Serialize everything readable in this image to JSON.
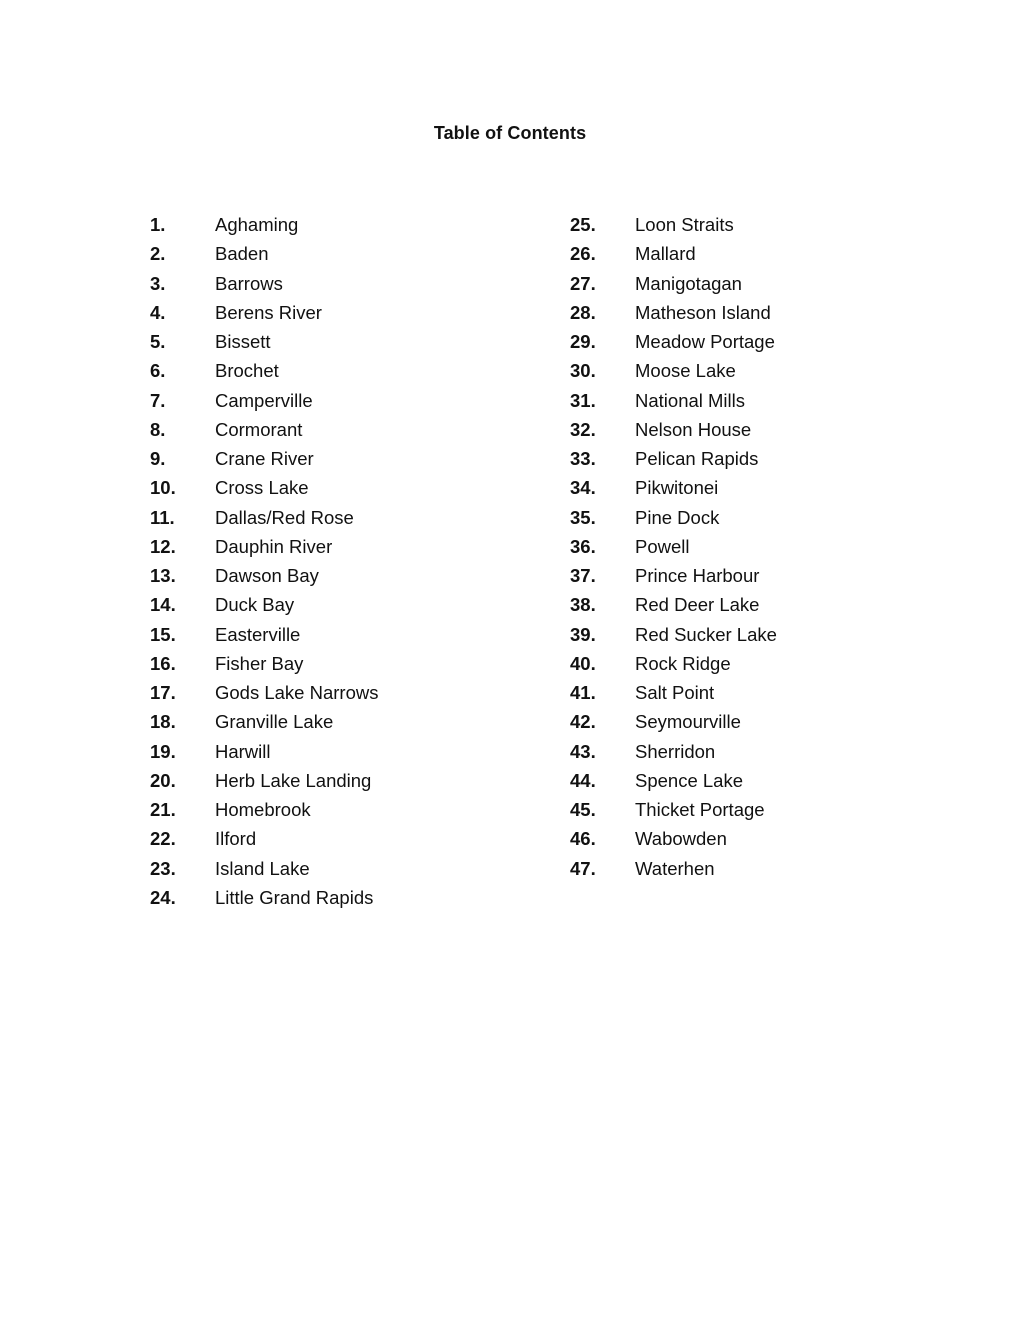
{
  "document": {
    "title": "Table of Contents",
    "columns": [
      {
        "entries": [
          {
            "number": "1.",
            "name": "Aghaming"
          },
          {
            "number": "2.",
            "name": "Baden"
          },
          {
            "number": "3.",
            "name": "Barrows"
          },
          {
            "number": "4.",
            "name": "Berens River"
          },
          {
            "number": "5.",
            "name": "Bissett"
          },
          {
            "number": "6.",
            "name": "Brochet"
          },
          {
            "number": "7.",
            "name": "Camperville"
          },
          {
            "number": "8.",
            "name": "Cormorant"
          },
          {
            "number": "9.",
            "name": "Crane River"
          },
          {
            "number": "10.",
            "name": "Cross Lake"
          },
          {
            "number": "11.",
            "name": "Dallas/Red Rose"
          },
          {
            "number": "12.",
            "name": "Dauphin River"
          },
          {
            "number": "13.",
            "name": "Dawson Bay"
          },
          {
            "number": "14.",
            "name": "Duck Bay"
          },
          {
            "number": "15.",
            "name": "Easterville"
          },
          {
            "number": "16.",
            "name": "Fisher Bay"
          },
          {
            "number": "17.",
            "name": "Gods Lake Narrows"
          },
          {
            "number": "18.",
            "name": "Granville Lake"
          },
          {
            "number": "19.",
            "name": "Harwill"
          },
          {
            "number": "20.",
            "name": "Herb Lake Landing"
          },
          {
            "number": "21.",
            "name": "Homebrook"
          },
          {
            "number": "22.",
            "name": "Ilford"
          },
          {
            "number": "23.",
            "name": "Island Lake"
          },
          {
            "number": "24.",
            "name": "Little Grand Rapids"
          }
        ]
      },
      {
        "entries": [
          {
            "number": "25.",
            "name": "Loon Straits"
          },
          {
            "number": "26.",
            "name": "Mallard"
          },
          {
            "number": "27.",
            "name": "Manigotagan"
          },
          {
            "number": "28.",
            "name": "Matheson Island"
          },
          {
            "number": "29.",
            "name": "Meadow Portage"
          },
          {
            "number": "30.",
            "name": "Moose Lake"
          },
          {
            "number": "31.",
            "name": "National Mills"
          },
          {
            "number": "32.",
            "name": "Nelson House"
          },
          {
            "number": "33.",
            "name": "Pelican Rapids"
          },
          {
            "number": "34.",
            "name": "Pikwitonei"
          },
          {
            "number": "35.",
            "name": "Pine Dock"
          },
          {
            "number": "36.",
            "name": "Powell"
          },
          {
            "number": "37.",
            "name": "Prince Harbour"
          },
          {
            "number": "38.",
            "name": "Red Deer Lake"
          },
          {
            "number": "39.",
            "name": "Red Sucker Lake"
          },
          {
            "number": "40.",
            "name": "Rock Ridge"
          },
          {
            "number": "41.",
            "name": "Salt Point"
          },
          {
            "number": "42.",
            "name": "Seymourville"
          },
          {
            "number": "43.",
            "name": "Sherridon"
          },
          {
            "number": "44.",
            "name": "Spence Lake"
          },
          {
            "number": "45.",
            "name": "Thicket Portage"
          },
          {
            "number": "46.",
            "name": "Wabowden"
          },
          {
            "number": "47.",
            "name": "Waterhen"
          }
        ]
      }
    ]
  }
}
